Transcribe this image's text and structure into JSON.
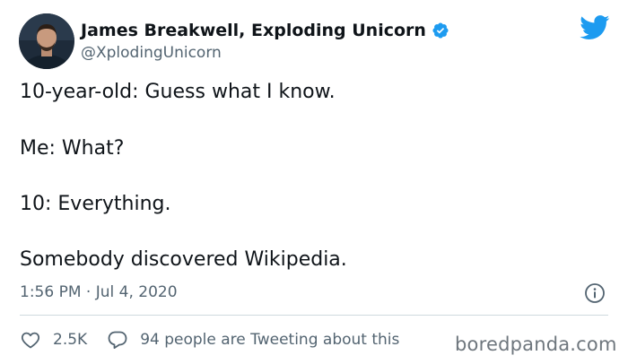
{
  "author": {
    "display_name": "James Breakwell, Exploding Unicorn",
    "handle": "@XplodingUnicorn",
    "verified": true,
    "avatar_icon": "profile-photo"
  },
  "tweet": {
    "lines": [
      "10-year-old: Guess what I know.",
      "Me: What?",
      "10: Everything.",
      "Somebody discovered Wikipedia."
    ],
    "timestamp": "1:56 PM · Jul 4, 2020"
  },
  "actions": {
    "like_count": "2.5K",
    "reply_text": "94 people are Tweeting about this"
  },
  "watermark": "boredpanda.com",
  "icons": {
    "brand": "twitter-bird-icon",
    "verified": "verified-badge-icon",
    "info": "info-icon",
    "like": "heart-icon",
    "reply": "reply-bubble-icon"
  },
  "colors": {
    "twitter_blue": "#1d9bf0",
    "text_primary": "#0f1419",
    "text_secondary": "#536471",
    "divider": "#cfd9de",
    "watermark": "#6e767d"
  }
}
